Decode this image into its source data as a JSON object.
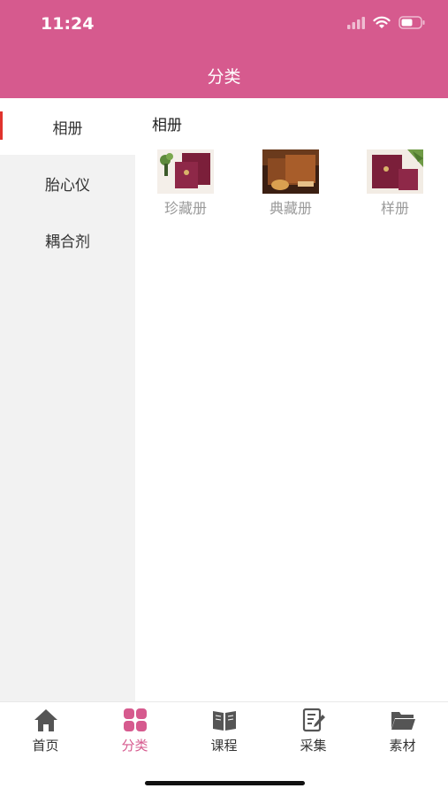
{
  "status_bar": {
    "time": "11:24",
    "icons": [
      "cellular-signal-icon",
      "wifi-icon",
      "battery-icon"
    ]
  },
  "nav": {
    "title": "分类"
  },
  "sidebar": {
    "items": [
      {
        "label": "相册",
        "active": true
      },
      {
        "label": "胎心仪",
        "active": false
      },
      {
        "label": "耦合剂",
        "active": false
      }
    ]
  },
  "content": {
    "section_title": "相册",
    "products": [
      {
        "label": "珍藏册",
        "image": "collection-album-thumbnail"
      },
      {
        "label": "典藏册",
        "image": "classic-album-thumbnail"
      },
      {
        "label": "样册",
        "image": "sample-album-thumbnail"
      }
    ]
  },
  "tabbar": {
    "items": [
      {
        "label": "首页",
        "icon": "home-icon",
        "active": false
      },
      {
        "label": "分类",
        "icon": "grid-icon",
        "active": true
      },
      {
        "label": "课程",
        "icon": "book-icon",
        "active": false
      },
      {
        "label": "采集",
        "icon": "edit-document-icon",
        "active": false
      },
      {
        "label": "素材",
        "icon": "folder-icon",
        "active": false
      }
    ]
  },
  "colors": {
    "brand": "#d65a8e",
    "active_indicator": "#e0332d",
    "sidebar_bg": "#f2f2f2",
    "tab_icon": "#555555"
  }
}
